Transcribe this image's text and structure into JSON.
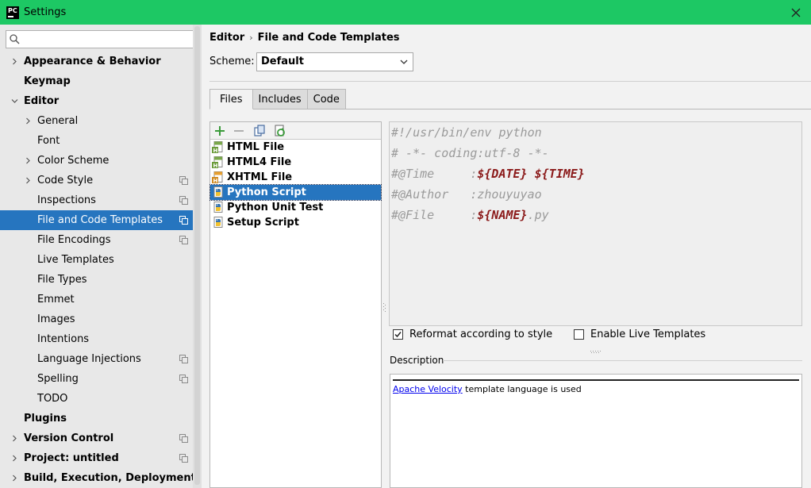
{
  "window": {
    "app_icon_text": "PC",
    "title": "Settings"
  },
  "search": {
    "placeholder": "",
    "value": ""
  },
  "sidebar": {
    "items": [
      {
        "label": "Appearance & Behavior",
        "level": 0,
        "bold": true,
        "arrow": "right",
        "project_icon": false,
        "selected": false
      },
      {
        "label": "Keymap",
        "level": 0,
        "bold": true,
        "arrow": "none",
        "project_icon": false,
        "selected": false
      },
      {
        "label": "Editor",
        "level": 0,
        "bold": true,
        "arrow": "down",
        "project_icon": false,
        "selected": false
      },
      {
        "label": "General",
        "level": 1,
        "bold": false,
        "arrow": "right",
        "project_icon": false,
        "selected": false
      },
      {
        "label": "Font",
        "level": 1,
        "bold": false,
        "arrow": "none",
        "project_icon": false,
        "selected": false
      },
      {
        "label": "Color Scheme",
        "level": 1,
        "bold": false,
        "arrow": "right",
        "project_icon": false,
        "selected": false
      },
      {
        "label": "Code Style",
        "level": 1,
        "bold": false,
        "arrow": "right",
        "project_icon": true,
        "selected": false
      },
      {
        "label": "Inspections",
        "level": 1,
        "bold": false,
        "arrow": "none",
        "project_icon": true,
        "selected": false
      },
      {
        "label": "File and Code Templates",
        "level": 1,
        "bold": false,
        "arrow": "none",
        "project_icon": true,
        "selected": true
      },
      {
        "label": "File Encodings",
        "level": 1,
        "bold": false,
        "arrow": "none",
        "project_icon": true,
        "selected": false
      },
      {
        "label": "Live Templates",
        "level": 1,
        "bold": false,
        "arrow": "none",
        "project_icon": false,
        "selected": false
      },
      {
        "label": "File Types",
        "level": 1,
        "bold": false,
        "arrow": "none",
        "project_icon": false,
        "selected": false
      },
      {
        "label": "Emmet",
        "level": 1,
        "bold": false,
        "arrow": "none",
        "project_icon": false,
        "selected": false
      },
      {
        "label": "Images",
        "level": 1,
        "bold": false,
        "arrow": "none",
        "project_icon": false,
        "selected": false
      },
      {
        "label": "Intentions",
        "level": 1,
        "bold": false,
        "arrow": "none",
        "project_icon": false,
        "selected": false
      },
      {
        "label": "Language Injections",
        "level": 1,
        "bold": false,
        "arrow": "none",
        "project_icon": true,
        "selected": false
      },
      {
        "label": "Spelling",
        "level": 1,
        "bold": false,
        "arrow": "none",
        "project_icon": true,
        "selected": false
      },
      {
        "label": "TODO",
        "level": 1,
        "bold": false,
        "arrow": "none",
        "project_icon": false,
        "selected": false
      },
      {
        "label": "Plugins",
        "level": 0,
        "bold": true,
        "arrow": "none",
        "project_icon": false,
        "selected": false
      },
      {
        "label": "Version Control",
        "level": 0,
        "bold": true,
        "arrow": "right",
        "project_icon": true,
        "selected": false
      },
      {
        "label": "Project: untitled",
        "level": 0,
        "bold": true,
        "arrow": "right",
        "project_icon": true,
        "selected": false
      },
      {
        "label": "Build, Execution, Deployment",
        "level": 0,
        "bold": true,
        "arrow": "right",
        "project_icon": false,
        "selected": false
      }
    ]
  },
  "breadcrumb": {
    "parent": "Editor",
    "separator": "›",
    "current": "File and Code Templates"
  },
  "scheme": {
    "label": "Scheme:",
    "value": "Default"
  },
  "tabs": [
    {
      "label": "Files",
      "active": true
    },
    {
      "label": "Includes",
      "active": false
    },
    {
      "label": "Code",
      "active": false
    }
  ],
  "toolbar": {
    "icons": [
      "add-icon",
      "remove-icon",
      "copy-icon",
      "reset-icon"
    ]
  },
  "files": [
    {
      "name": "HTML File",
      "icon": "html-file-icon",
      "selected": false
    },
    {
      "name": "HTML4 File",
      "icon": "html-file-icon",
      "selected": false
    },
    {
      "name": "XHTML File",
      "icon": "xhtml-file-icon",
      "selected": false
    },
    {
      "name": "Python Script",
      "icon": "python-file-icon",
      "selected": true
    },
    {
      "name": "Python Unit Test",
      "icon": "python-file-icon",
      "selected": false
    },
    {
      "name": "Setup Script",
      "icon": "python-file-icon",
      "selected": false
    }
  ],
  "editor": {
    "lines": [
      {
        "text": "#!/usr/bin/env python"
      },
      {
        "text": "# -*- coding:utf-8 -*-"
      },
      {
        "prefix": "#@Time     :",
        "var1": "${DATE}",
        "mid": " ",
        "var2": "${TIME}",
        "suffix": ""
      },
      {
        "text": "#@Author   :zhouyuyao"
      },
      {
        "prefix": "#@File     :",
        "var1": "${NAME}",
        "mid": "",
        "var2": "",
        "suffix": ".py"
      }
    ]
  },
  "options": {
    "reformat": {
      "label": "Reformat according to style",
      "checked": true
    },
    "live_templates": {
      "label": "Enable Live Templates",
      "checked": false
    }
  },
  "description": {
    "label": "Description",
    "link_text": "Apache Velocity",
    "text": " template language is used"
  },
  "colors": {
    "titlebar": "#1dc864",
    "selection": "#2675bf",
    "template_variable": "#8b1a1a",
    "comment": "#9a9a9a"
  }
}
